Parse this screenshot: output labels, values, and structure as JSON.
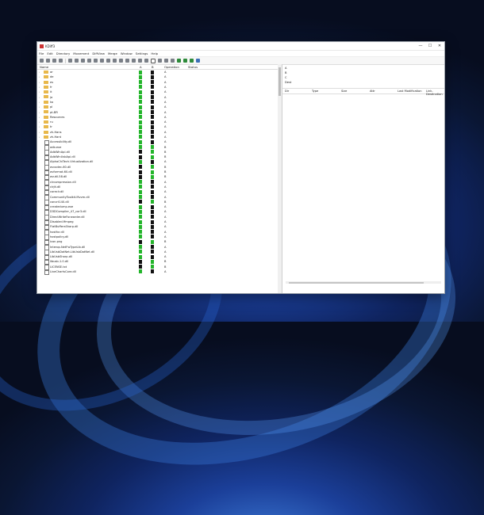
{
  "window": {
    "title": "KDiff3"
  },
  "window_controls": {
    "minimize": "—",
    "maximize": "☐",
    "close": "✕"
  },
  "menu": [
    "File",
    "Edit",
    "Directory",
    "Movement",
    "DiffView",
    "Merge",
    "Window",
    "Settings",
    "Help"
  ],
  "left_pane": {
    "headers": {
      "name": "Name",
      "a": "A",
      "b": "B",
      "operation": "Operation",
      "status": "Status"
    },
    "rows": [
      {
        "name": "ar",
        "type": "folder",
        "a": "green",
        "b": "black",
        "op": "A"
      },
      {
        "name": "de",
        "type": "folder",
        "a": "green",
        "b": "black",
        "op": "A"
      },
      {
        "name": "es",
        "type": "folder",
        "a": "green",
        "b": "black",
        "op": "A"
      },
      {
        "name": "fr",
        "type": "folder",
        "a": "green",
        "b": "black",
        "op": "A"
      },
      {
        "name": "it",
        "type": "folder",
        "a": "green",
        "b": "black",
        "op": "A"
      },
      {
        "name": "ja",
        "type": "folder",
        "a": "green",
        "b": "black",
        "op": "A"
      },
      {
        "name": "ko",
        "type": "folder",
        "a": "green",
        "b": "black",
        "op": "A"
      },
      {
        "name": "pl",
        "type": "folder",
        "a": "green",
        "b": "black",
        "op": "A"
      },
      {
        "name": "pt-BR",
        "type": "folder",
        "a": "green",
        "b": "black",
        "op": "A"
      },
      {
        "name": "Resources",
        "type": "folder",
        "a": "green",
        "b": "black",
        "op": "A"
      },
      {
        "name": "ru",
        "type": "folder",
        "a": "green",
        "b": "black",
        "op": "A"
      },
      {
        "name": "tr",
        "type": "folder",
        "a": "green",
        "b": "black",
        "op": "A"
      },
      {
        "name": "zh-Hans",
        "type": "folder",
        "a": "green",
        "b": "black",
        "op": "A"
      },
      {
        "name": "zh-Hant",
        "type": "folder",
        "a": "green",
        "b": "black",
        "op": "A"
      },
      {
        "name": "Accessibility.dll",
        "type": "file",
        "a": "green",
        "b": "black",
        "op": "A"
      },
      {
        "name": "adb.exe",
        "type": "file",
        "a": "green",
        "b": "green",
        "op": "B"
      },
      {
        "name": "AdbWinApi.dll",
        "type": "file",
        "a": "black",
        "op": "B",
        "b": "green"
      },
      {
        "name": "AdbWinUsbApi.dll",
        "type": "file",
        "a": "black",
        "b": "green",
        "op": "B"
      },
      {
        "name": "AlphaChiTech.Virtualization.dll",
        "type": "file",
        "a": "green",
        "b": "black",
        "op": "A"
      },
      {
        "name": "avcodec-60.dll",
        "type": "file",
        "a": "black",
        "b": "green",
        "op": "B"
      },
      {
        "name": "avformat-60.dll",
        "type": "file",
        "a": "black",
        "b": "green",
        "op": "B"
      },
      {
        "name": "avutil-58.dll",
        "type": "file",
        "a": "black",
        "b": "green",
        "op": "B"
      },
      {
        "name": "clrcompression.dll",
        "type": "file",
        "a": "green",
        "b": "black",
        "op": "A"
      },
      {
        "name": "clrjit.dll",
        "type": "file",
        "a": "green",
        "b": "black",
        "op": "A"
      },
      {
        "name": "coreclr.dll",
        "type": "file",
        "a": "green",
        "b": "black",
        "op": "A"
      },
      {
        "name": "CommunityToolkit.Mvvm.dll",
        "type": "file",
        "a": "green",
        "b": "black",
        "op": "A"
      },
      {
        "name": "concrt140.dll",
        "type": "file",
        "a": "black",
        "b": "green",
        "op": "B"
      },
      {
        "name": "createdump.exe",
        "type": "file",
        "a": "green",
        "b": "black",
        "op": "A"
      },
      {
        "name": "D3DCompiler_47_cor3.dll",
        "type": "file",
        "a": "green",
        "b": "black",
        "op": "A"
      },
      {
        "name": "DirectWriteForwarder.dll",
        "type": "file",
        "a": "green",
        "b": "black",
        "op": "A"
      },
      {
        "name": "Disabled.ffmpeg",
        "type": "file",
        "a": "green",
        "b": "black",
        "op": "A"
      },
      {
        "name": "FlatBuffersSharp.dll",
        "type": "file",
        "a": "green",
        "b": "black",
        "op": "A"
      },
      {
        "name": "hostfxr.dll",
        "type": "file",
        "a": "green",
        "b": "black",
        "op": "A"
      },
      {
        "name": "hostpolicy.dll",
        "type": "file",
        "a": "green",
        "b": "black",
        "op": "A"
      },
      {
        "name": "icon.png",
        "type": "file",
        "a": "black",
        "b": "green",
        "op": "B"
      },
      {
        "name": "Interop.NetFwTypeLib.dll",
        "type": "file",
        "a": "green",
        "b": "black",
        "op": "A"
      },
      {
        "name": "LibUsbDotNet.LibUsbDotNet.dll",
        "type": "file",
        "a": "green",
        "b": "black",
        "op": "A"
      },
      {
        "name": "LibUsbSharp.dll",
        "type": "file",
        "a": "green",
        "b": "black",
        "op": "A"
      },
      {
        "name": "libusb-1.0.dll",
        "type": "file",
        "a": "black",
        "b": "green",
        "op": "B"
      },
      {
        "name": "LICENSE.txt",
        "type": "file",
        "a": "black",
        "b": "green",
        "op": "B"
      },
      {
        "name": "LiveChartsCore.dll",
        "type": "file",
        "a": "green",
        "b": "black",
        "op": "A"
      }
    ]
  },
  "right_pane": {
    "attributes": [
      "A",
      "B",
      "C",
      "Dest"
    ],
    "headers": {
      "dir": "Dir",
      "type": "Type",
      "size": "Size",
      "attr": "Attr",
      "last_mod": "Last Modification",
      "link": "Link-Destination"
    }
  },
  "colors": {
    "green": "#23b52a",
    "black": "#111111",
    "folder": "#e8b84a"
  }
}
